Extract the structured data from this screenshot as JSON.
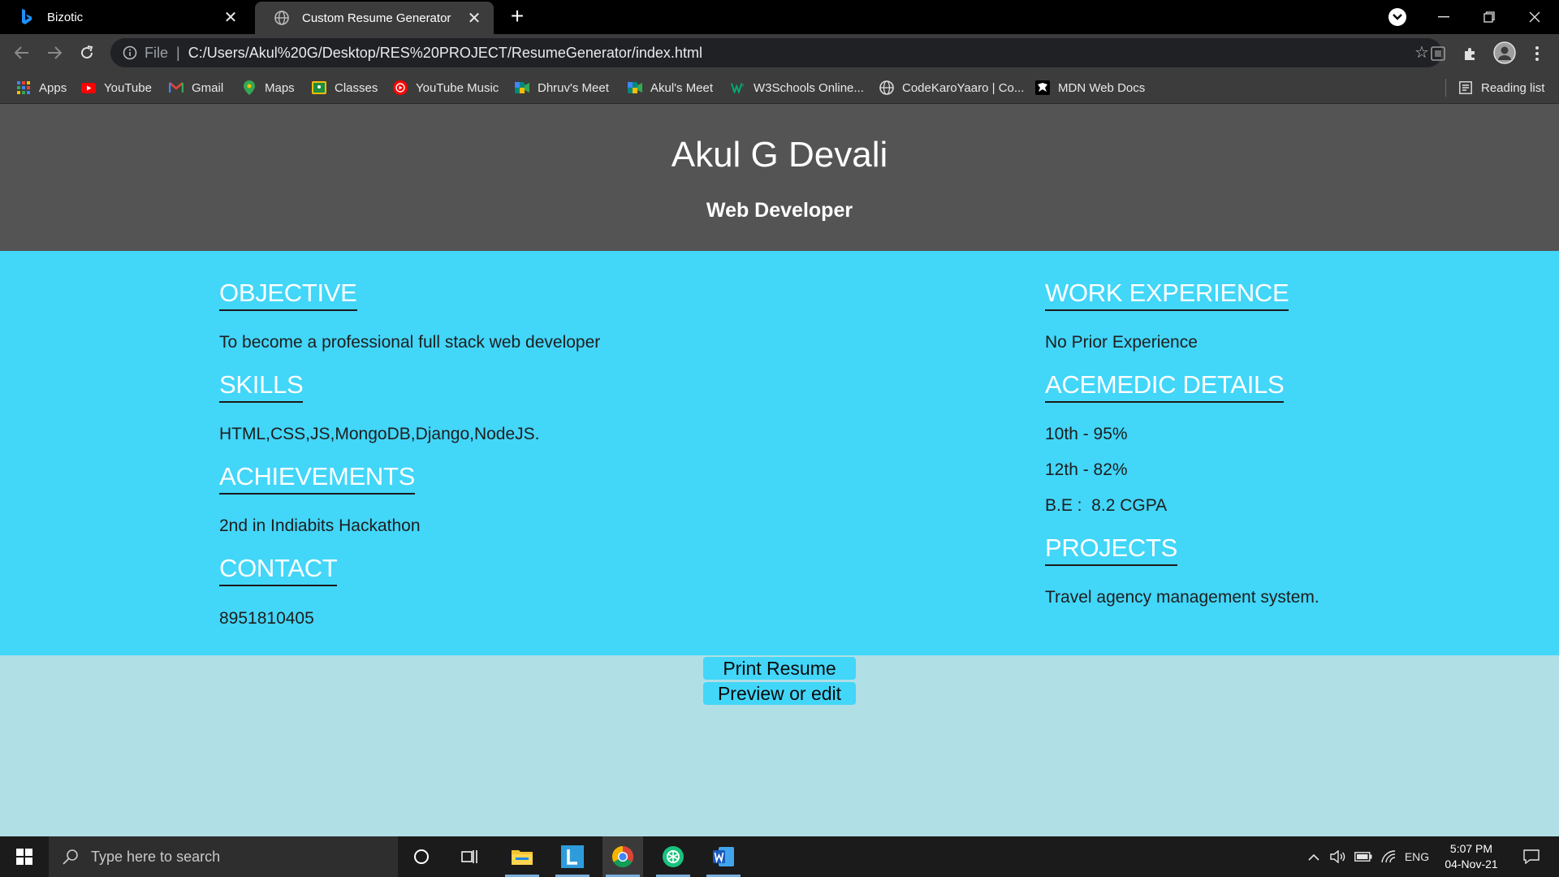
{
  "browser": {
    "tabs": [
      {
        "title": "Bizotic",
        "active": false
      },
      {
        "title": "Custom Resume Generator",
        "active": true
      }
    ],
    "new_tab": "+",
    "address": {
      "scheme": "File",
      "separator": "|",
      "url": "C:/Users/Akul%20G/Desktop/RES%20PROJECT/ResumeGenerator/index.html"
    },
    "bookmarks": [
      {
        "label": "Apps",
        "icon": "apps-grid-icon",
        "color": "#4285f4"
      },
      {
        "label": "YouTube",
        "icon": "youtube-icon",
        "color": "#ff0000"
      },
      {
        "label": "Gmail",
        "icon": "gmail-icon",
        "color": "#ea4335"
      },
      {
        "label": "Maps",
        "icon": "maps-pin-icon",
        "color": "#34a853"
      },
      {
        "label": "Classes",
        "icon": "classroom-icon",
        "color": "#fbbc04"
      },
      {
        "label": "YouTube Music",
        "icon": "youtube-music-icon",
        "color": "#ff0000"
      },
      {
        "label": "Dhruv's Meet",
        "icon": "meet-icon",
        "color": "#00897b"
      },
      {
        "label": "Akul's Meet",
        "icon": "meet-icon",
        "color": "#00897b"
      },
      {
        "label": "W3Schools Online...",
        "icon": "w3schools-icon",
        "color": "#04aa6d"
      },
      {
        "label": "CodeKaroYaaro | Co...",
        "icon": "globe-icon",
        "color": "#dcdcdc"
      },
      {
        "label": "MDN Web Docs",
        "icon": "mdn-icon",
        "color": "#ffffff"
      }
    ],
    "reading_list": "Reading list"
  },
  "resume": {
    "name": "Akul G Devali",
    "role": "Web Developer",
    "left": [
      {
        "title": "OBJECTIVE",
        "lines": [
          "To become a professional full stack web developer"
        ]
      },
      {
        "title": "SKILLS",
        "lines": [
          "HTML,CSS,JS,MongoDB,Django,NodeJS."
        ]
      },
      {
        "title": "ACHIEVEMENTS",
        "lines": [
          "2nd in Indiabits Hackathon"
        ]
      },
      {
        "title": "CONTACT",
        "lines": [
          "8951810405"
        ]
      }
    ],
    "right": [
      {
        "title": "WORK EXPERIENCE",
        "lines": [
          "No Prior Experience"
        ]
      },
      {
        "title": "ACEMEDIC DETAILS",
        "lines": [
          "10th - 95%",
          "12th - 82%",
          "B.E :  8.2 CGPA"
        ]
      },
      {
        "title": "PROJECTS",
        "lines": [
          "Travel agency management system."
        ]
      }
    ]
  },
  "actions": {
    "print_label": "Print Resume",
    "edit_label": "Preview or edit"
  },
  "taskbar": {
    "search_placeholder": "Type here to search",
    "language": "ENG",
    "time": "5:07 PM",
    "date": "04-Nov-21"
  },
  "colors": {
    "header_bg": "#545454",
    "body_bg": "#42d6f9",
    "page_bg": "#b0dfe6"
  }
}
